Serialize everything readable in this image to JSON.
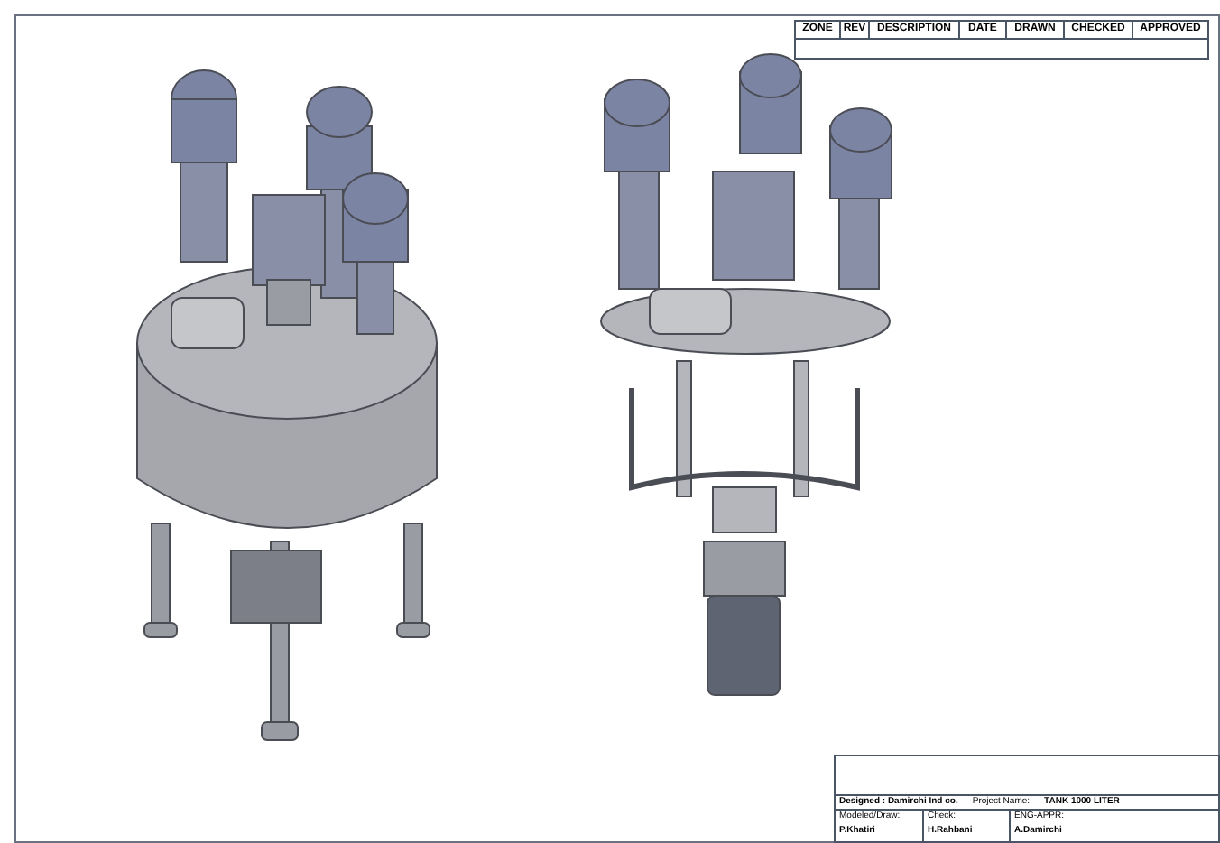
{
  "revision_table": {
    "columns": [
      "ZONE",
      "REV",
      "DESCRIPTION",
      "DATE",
      "DRAWN",
      "CHECKED",
      "APPROVED"
    ]
  },
  "title_block": {
    "designed": "Designed : Damirchi Ind co.",
    "project_label": "Project Name:",
    "project_name": "TANK 1000 LITER",
    "signatures": [
      {
        "role": "Modeled/Draw:",
        "name": "P.Khatiri"
      },
      {
        "role": "Check:",
        "name": "H.Rahbani"
      },
      {
        "role": "ENG-APPR:",
        "name": "A.Damirchi"
      }
    ]
  }
}
